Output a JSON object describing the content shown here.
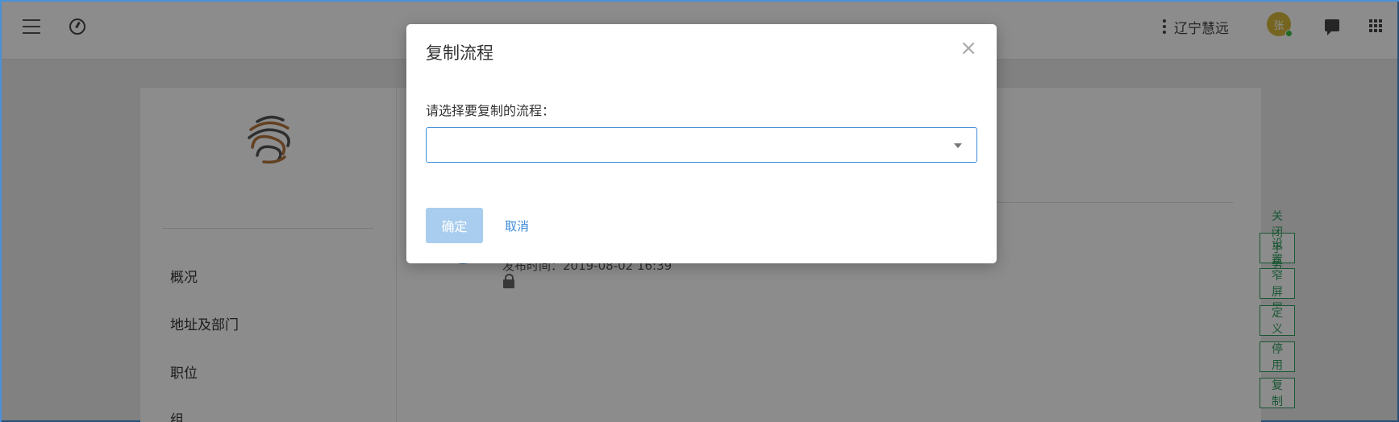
{
  "topbar": {
    "org_name": "辽宁慧远",
    "avatar_initial": "张"
  },
  "sidebar": {
    "items": [
      {
        "label": "概况"
      },
      {
        "label": "地址及部门"
      },
      {
        "label": "职位"
      },
      {
        "label": "组"
      }
    ]
  },
  "main": {
    "publish_time": "发布时间：2019-08-02 16:39",
    "actions": [
      {
        "label": "关闭手势码"
      },
      {
        "label": "设置窄屏展示"
      },
      {
        "label": "定义"
      },
      {
        "label": "停用"
      },
      {
        "label": "复制"
      }
    ]
  },
  "modal": {
    "title": "复制流程",
    "close_glyph": "×",
    "select_label": "请选择要复制的流程：",
    "select_value": "",
    "confirm_label": "确定",
    "cancel_label": "取消"
  },
  "colors": {
    "accent": "#3b8ad8",
    "action_green": "#2e9e5e",
    "confirm_disabled": "#a9cdee"
  }
}
